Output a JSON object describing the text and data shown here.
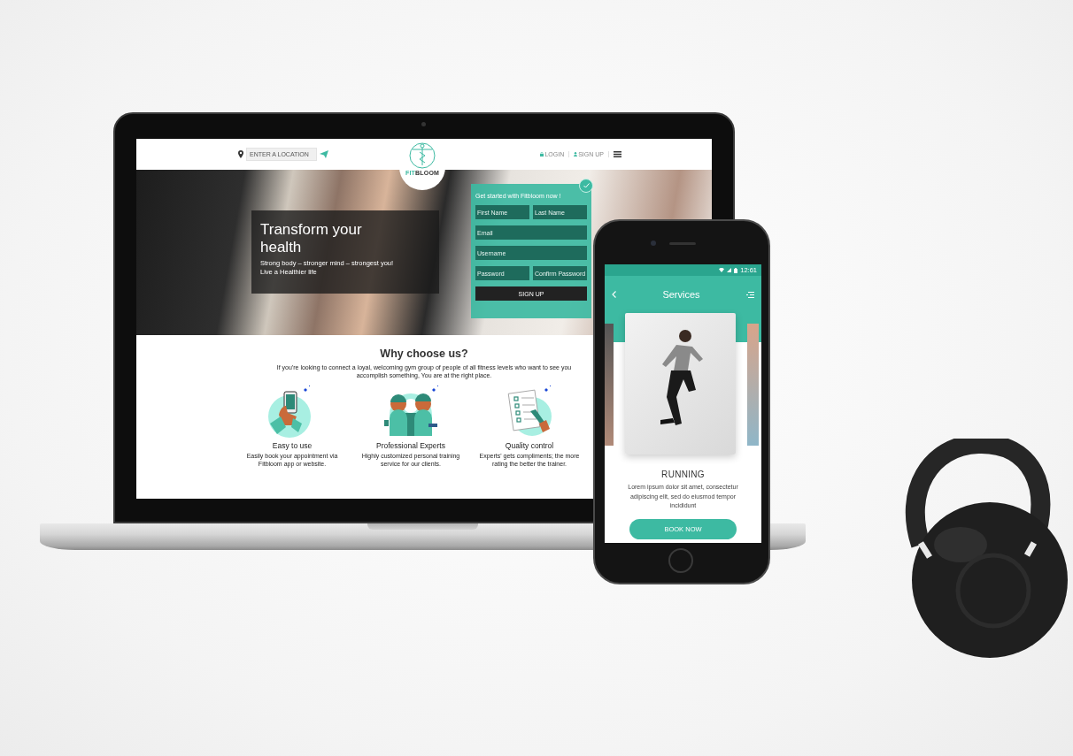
{
  "laptop": {
    "header": {
      "location_placeholder": "ENTER A LOCATION",
      "logo": {
        "accent": "FIT",
        "rest": "BLOOM"
      },
      "nav": [
        {
          "label": "LOGIN",
          "kind": "login"
        },
        {
          "label": "SIGN UP",
          "kind": "signup"
        }
      ]
    },
    "hero": {
      "title": "Transform your health",
      "subtitle": "Strong body – stronger mind – strongest you!",
      "tagline": "Live a Healthier life"
    },
    "signup_form": {
      "title": "Get started with Fitbloom now !",
      "fields": [
        {
          "placeholder": "First Name",
          "kind": "half"
        },
        {
          "placeholder": "Last Name",
          "kind": "half"
        },
        {
          "placeholder": "Email",
          "kind": "full"
        },
        {
          "placeholder": "Username",
          "kind": "full"
        },
        {
          "placeholder": "Password",
          "kind": "half"
        },
        {
          "placeholder": "Confirm Password",
          "kind": "half"
        }
      ],
      "button": "SIGN UP"
    },
    "features_section": {
      "title": "Why choose us?",
      "intro": "If you're looking to connect a loyal, welcoming gym group of people of all fitness levels who want to see you accomplish something, You are at the right place.",
      "features": [
        {
          "kind": "phone",
          "title": "Easy to use",
          "description": "Easily book your appointment via Fitbloom app or website."
        },
        {
          "kind": "people",
          "title": "Professional Experts",
          "description": "Highly customized personal training service for our clients."
        },
        {
          "kind": "checklist",
          "title": "Quality control",
          "description": "Experts' gets compliments; the more rating the better the trainer."
        }
      ]
    }
  },
  "phone": {
    "status_time": "12:61",
    "title": "Services",
    "card_title": "RUNNING",
    "card_text": "Lorem ipsum dolor sit amet, consectetur adipiscing elit, sed do eiusmod tempor incididunt",
    "button": "BOOK NOW"
  }
}
